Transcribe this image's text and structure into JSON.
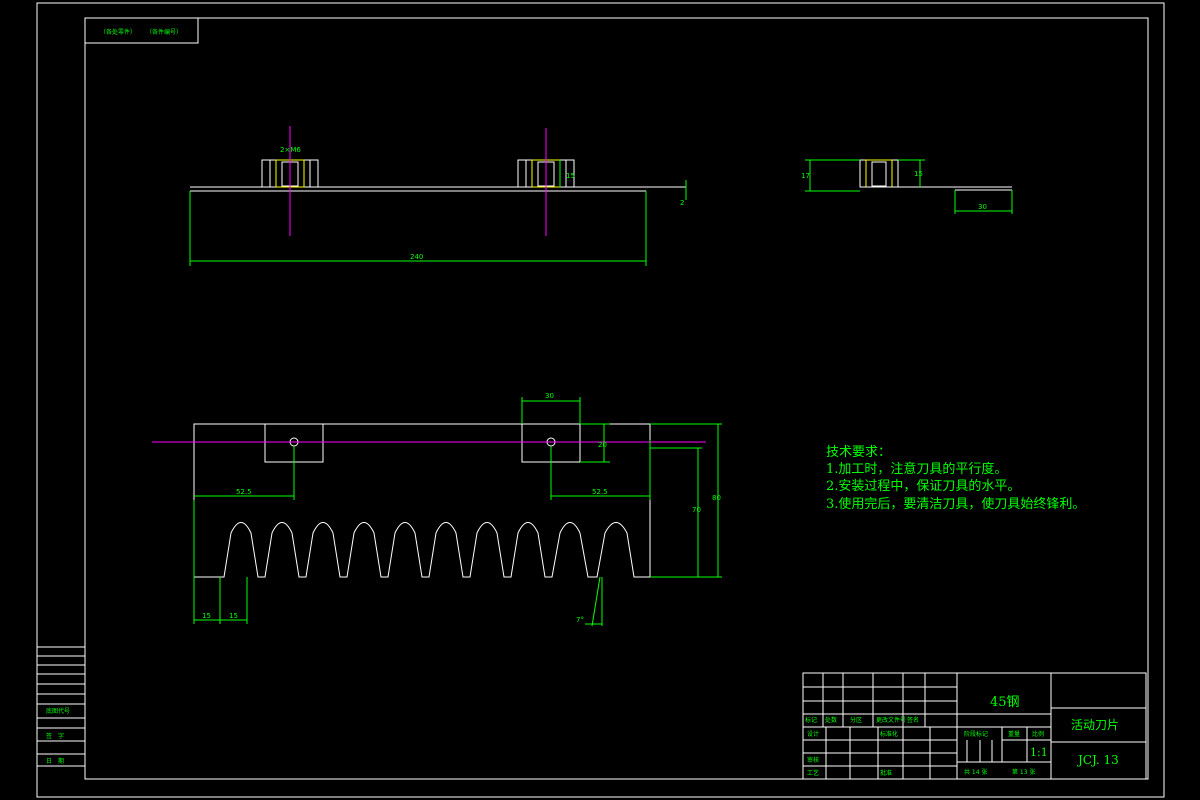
{
  "top_labels": [
    "（各处零件）",
    "（各件编号）"
  ],
  "dims": {
    "front_width": "240",
    "front_thread": "2×M6",
    "front_rise": "2",
    "front_boss_h": "15",
    "side_h": "17",
    "side_boss_h": "15",
    "side_len": "30",
    "plan_boss_w": "30",
    "plan_boss_h": "20",
    "plan_left": "52.5",
    "plan_right": "52.5",
    "plan_h70": "70",
    "plan_h80": "80",
    "plan_t1": "15",
    "plan_t2": "15",
    "plan_angle": "7°"
  },
  "tech": {
    "title": "技术要求：",
    "items": [
      "1.加工时，注意刀具的平行度。",
      "2.安装过程中，保证刀具的水平。",
      "3.使用完后，要清洁刀具，使刀具始终锋利。"
    ]
  },
  "left_table": [
    "底图代号",
    "签　字",
    "日　期"
  ],
  "title_block": {
    "material": "45钢",
    "part_name": "活动刀片",
    "drawing_no": "JCJ. 13",
    "scale": "1:1",
    "sheets_total": "共 14 张",
    "sheet_no": "第 13 张",
    "stage_label": "阶段标记",
    "weight_label": "重量",
    "scale_label": "比例",
    "rev_labels": [
      "标记",
      "处数",
      "分区",
      "",
      "更改文件号",
      "签名"
    ],
    "rows": [
      "设计",
      "标准化",
      "审核",
      "工艺",
      "批准"
    ]
  }
}
